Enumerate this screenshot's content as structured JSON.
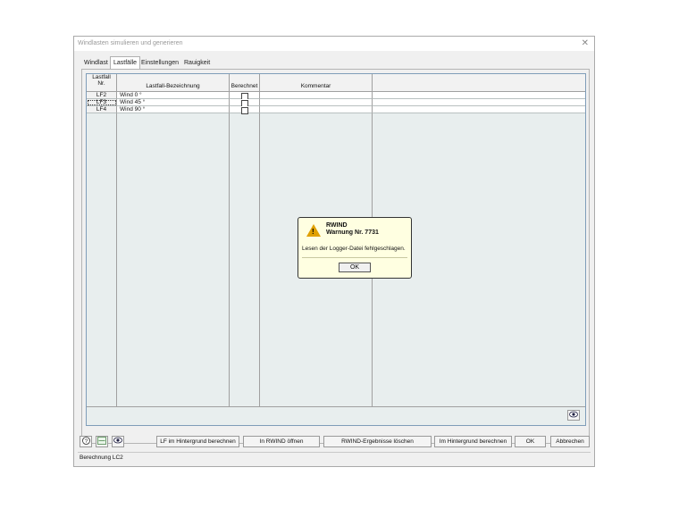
{
  "window": {
    "title": "Windlasten simulieren und generieren",
    "close_label": "✕"
  },
  "tabs": [
    "Windlast",
    "Lastfälle",
    "Einstellungen",
    "Rauigkeit"
  ],
  "table": {
    "headers": {
      "nr_line1": "Lastfall",
      "nr_line2": "Nr.",
      "bezeichnung": "Lastfall-Bezeichnung",
      "berechnet": "Berechnet",
      "kommentar": "Kommentar"
    },
    "rows": [
      {
        "nr": "LF2",
        "bezeichnung": "Wind 0 °",
        "berechnet": false,
        "kommentar": ""
      },
      {
        "nr": "LF3",
        "bezeichnung": "Wind 45 °",
        "berechnet": false,
        "kommentar": ""
      },
      {
        "nr": "LF4",
        "bezeichnung": "Wind 90 °",
        "berechnet": false,
        "kommentar": ""
      }
    ]
  },
  "dialog": {
    "title": "RWIND",
    "subtitle": "Warnung Nr. 7731",
    "message": "Lesen der Logger-Datei fehlgeschlagen.",
    "ok_label": "OK",
    "icon": "warning-icon",
    "icon_color": "#e0a000"
  },
  "buttons": {
    "lf_background": "LF im Hintergrund berechnen",
    "open_rwind": "In RWIND öffnen",
    "delete_results": "RWIND-Ergebnisse löschen",
    "background_calc": "Im Hintergrund berechnen",
    "ok": "OK",
    "cancel": "Abbrechen"
  },
  "icons": {
    "help": "help-icon",
    "units": "units-icon",
    "view": "eye-icon",
    "grid_view": "eye-icon"
  },
  "status": {
    "text": "Berechnung LC2"
  }
}
